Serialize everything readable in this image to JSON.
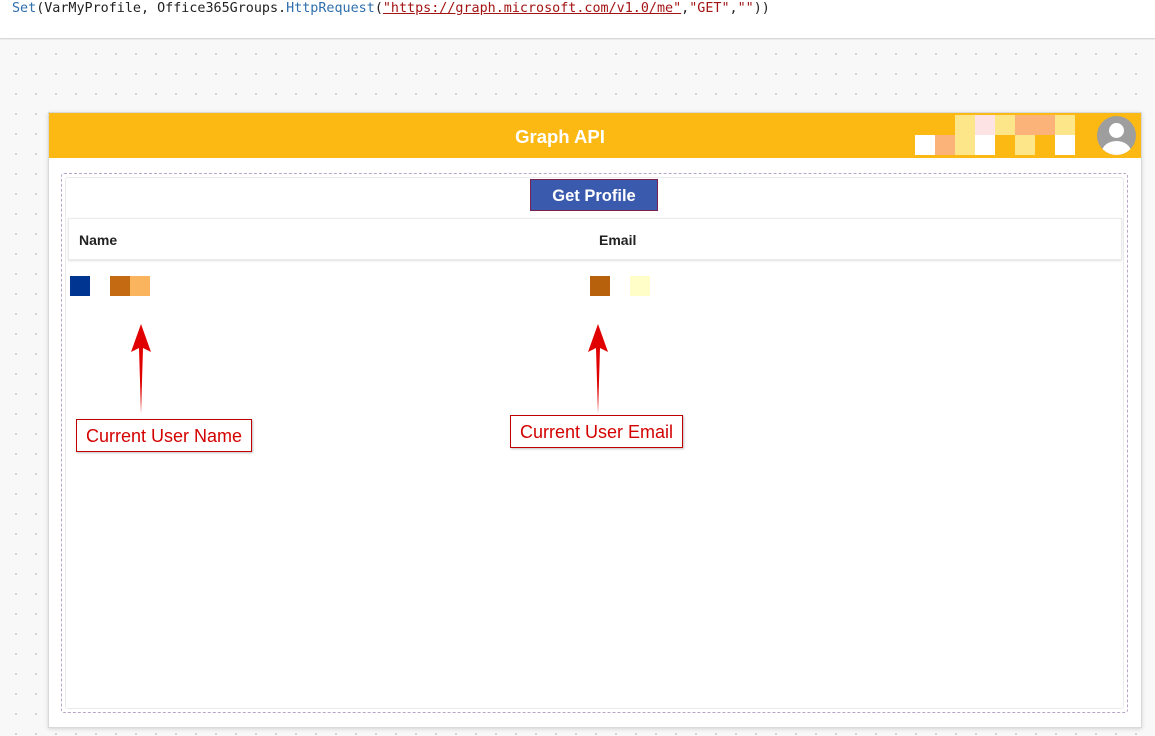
{
  "formula_bar": {
    "fn_set": "Set",
    "open1": "(",
    "var_name": "VarMyProfile, ",
    "connector": "Office365Groups.",
    "fn_http": "HttpRequest",
    "open2": "(",
    "url": "\"https://graph.microsoft.com/v1.0/me\"",
    "comma1": ",",
    "method": "\"GET\"",
    "comma2": ",",
    "empty_str": "\"\"",
    "close": "))"
  },
  "app": {
    "header_title": "Graph API",
    "get_profile_label": "Get Profile",
    "columns": {
      "name": "Name",
      "email": "Email"
    }
  },
  "annotations": {
    "user_name": "Current User Name",
    "user_email": "Current User Email"
  },
  "colors": {
    "header": "#fdb913",
    "button": "#3a5bad",
    "annotation": "#d40000"
  },
  "icons": [
    "user-avatar-icon",
    "arrow-up-icon"
  ]
}
